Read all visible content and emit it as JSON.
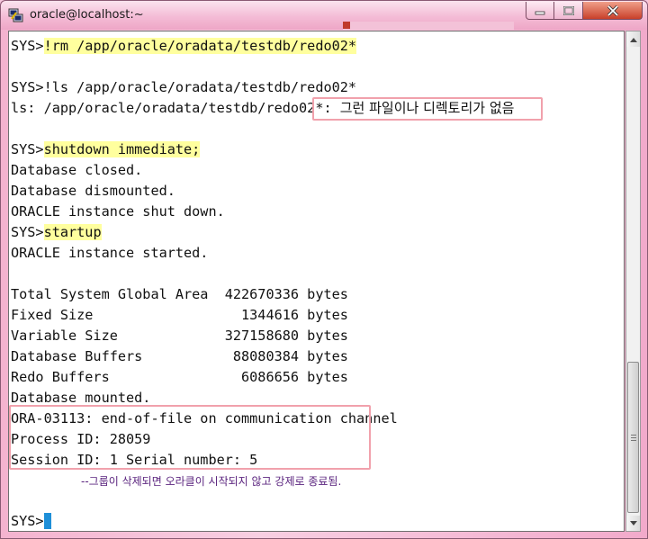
{
  "window": {
    "title": "oracle@localhost:~"
  },
  "terminal": {
    "lines": [
      {
        "prompt": "SYS>",
        "cmd": "!rm /app/oracle/oradata/testdb/redo02*"
      },
      {
        "text": ""
      },
      {
        "text": "SYS>!ls /app/oracle/oradata/testdb/redo02*"
      },
      {
        "prefix": "ls: /app/oracle/oradata/testdb/redo02*: ",
        "msg": "그런 파일이나 디렉토리가 없음"
      },
      {
        "text": ""
      },
      {
        "prompt": "SYS>",
        "cmd": "shutdown immediate;"
      },
      {
        "text": "Database closed."
      },
      {
        "text": "Database dismounted."
      },
      {
        "text": "ORACLE instance shut down."
      },
      {
        "prompt": "SYS>",
        "cmd": "startup"
      },
      {
        "text": "ORACLE instance started."
      },
      {
        "text": ""
      },
      {
        "text": "Total System Global Area  422670336 bytes"
      },
      {
        "text": "Fixed Size                  1344616 bytes"
      },
      {
        "text": "Variable Size             327158680 bytes"
      },
      {
        "text": "Database Buffers           88080384 bytes"
      },
      {
        "text": "Redo Buffers                6086656 bytes"
      },
      {
        "text": "Database mounted."
      },
      {
        "text": "ORA-03113: end-of-file on communication channel"
      },
      {
        "text": "Process ID: 28059"
      },
      {
        "text": "Session ID: 1 Serial number: 5"
      }
    ],
    "note": "--그룹이 삭제되면 오라클이 시작되지 않고 강제로 종료됨.",
    "final_prompt": "SYS>"
  },
  "colors": {
    "highlight": "#ffff9e",
    "annotation_box": "#f1a1ac",
    "note_text": "#5a237e",
    "cursor": "#1e8fd8"
  },
  "icons": {
    "app": "putty-icon",
    "minimize": "minimize-icon",
    "maximize": "maximize-icon",
    "close": "close-icon"
  }
}
